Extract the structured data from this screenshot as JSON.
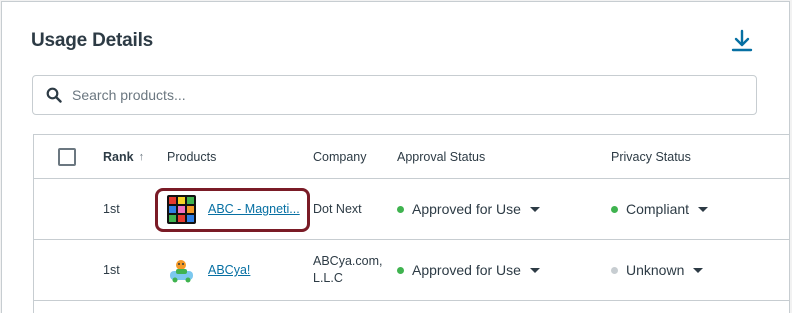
{
  "header": {
    "title": "Usage Details",
    "download_icon": "download-icon"
  },
  "search": {
    "placeholder": "Search products...",
    "value": "",
    "icon": "search-icon"
  },
  "table": {
    "columns": {
      "rank": "Rank",
      "products": "Products",
      "company": "Company",
      "approval": "Approval Status",
      "privacy": "Privacy Status"
    },
    "sort_indicator": "↑",
    "rows": [
      {
        "rank": "1st",
        "product": "ABC - Magneti...",
        "company": "Dot Next",
        "approval": "Approved for Use",
        "approval_color": "#3fb34f",
        "privacy": "Compliant",
        "privacy_color": "#3fb34f"
      },
      {
        "rank": "1st",
        "product": "ABCya!",
        "company_line1": "ABCya.com,",
        "company_line2": "L.L.C",
        "approval": "Approved for Use",
        "approval_color": "#3fb34f",
        "privacy": "Unknown",
        "privacy_color": "#c7cdd1"
      }
    ]
  },
  "colors": {
    "accent": "#0770a3",
    "highlight": "#7a1b26"
  }
}
